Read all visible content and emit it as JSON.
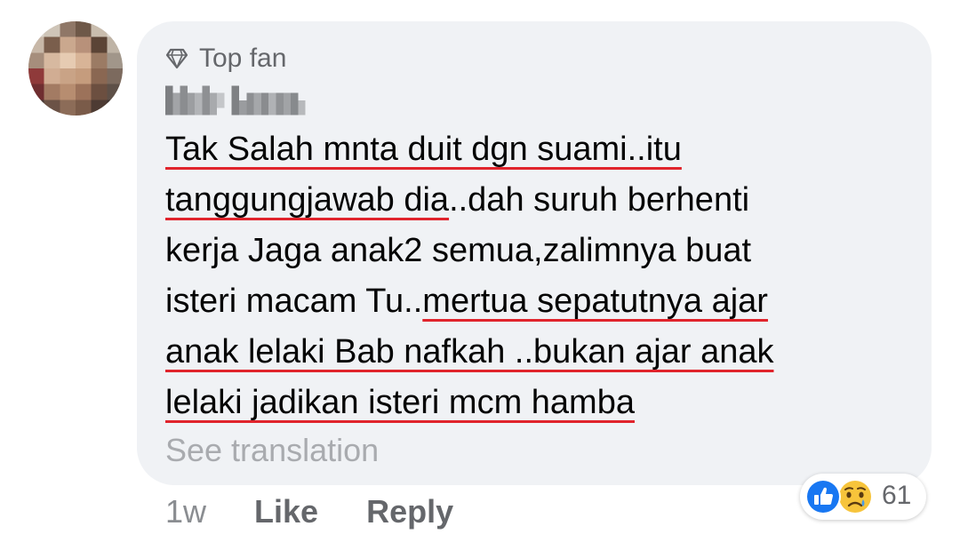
{
  "comment": {
    "badge": "Top fan",
    "author_name": "",
    "lines": [
      {
        "segments": [
          {
            "text": "Tak Salah mnta duit dgn suami..itu",
            "underline": true
          }
        ]
      },
      {
        "segments": [
          {
            "text": "tanggungjawab dia",
            "underline": true
          },
          {
            "text": "..dah suruh berhenti",
            "underline": false
          }
        ]
      },
      {
        "segments": [
          {
            "text": "kerja Jaga anak2 semua,zalimnya buat",
            "underline": false
          }
        ]
      },
      {
        "segments": [
          {
            "text": "isteri macam Tu..",
            "underline": false
          },
          {
            "text": "mertua sepatutnya ajar",
            "underline": true
          }
        ]
      },
      {
        "segments": [
          {
            "text": "anak lelaki Bab nafkah ..bukan ajar anak",
            "underline": true
          }
        ]
      },
      {
        "segments": [
          {
            "text": "lelaki jadikan isteri mcm hamba",
            "underline": true
          }
        ]
      }
    ],
    "see_translation": "See translation",
    "timestamp": "1w",
    "like_label": "Like",
    "reply_label": "Reply",
    "reaction_count": "61",
    "reactions": [
      "like-icon",
      "sad-icon"
    ]
  },
  "colors": {
    "bubble_bg": "#f0f2f5",
    "underline": "#e0242c",
    "text": "#050505",
    "secondary_text": "#65676b",
    "like_blue": "#1877f2"
  }
}
